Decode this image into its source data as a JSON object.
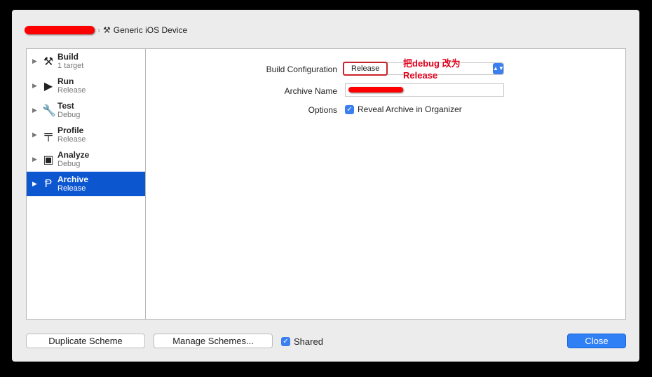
{
  "breadcrumb": {
    "device": "Generic iOS Device"
  },
  "sidebar": {
    "items": [
      {
        "title": "Build",
        "subtitle": "1 target",
        "icon": "hammer-icon"
      },
      {
        "title": "Run",
        "subtitle": "Release",
        "icon": "play-icon"
      },
      {
        "title": "Test",
        "subtitle": "Debug",
        "icon": "wrench-icon"
      },
      {
        "title": "Profile",
        "subtitle": "Release",
        "icon": "instruments-icon"
      },
      {
        "title": "Analyze",
        "subtitle": "Debug",
        "icon": "analyze-icon"
      },
      {
        "title": "Archive",
        "subtitle": "Release",
        "icon": "archive-icon",
        "selected": true
      }
    ]
  },
  "form": {
    "build_config_label": "Build Configuration",
    "build_config_value": "Release",
    "annotation_line1": "把debug 改为",
    "annotation_line2": "Release",
    "archive_name_label": "Archive Name",
    "options_label": "Options",
    "reveal_label": "Reveal Archive in Organizer",
    "reveal_checked": true
  },
  "footer": {
    "duplicate": "Duplicate Scheme",
    "manage": "Manage Schemes...",
    "shared": "Shared",
    "shared_checked": true,
    "close": "Close"
  },
  "colors": {
    "selection": "#0c56d0",
    "accent": "#2f7ff5",
    "annotation": "#e0001b"
  }
}
